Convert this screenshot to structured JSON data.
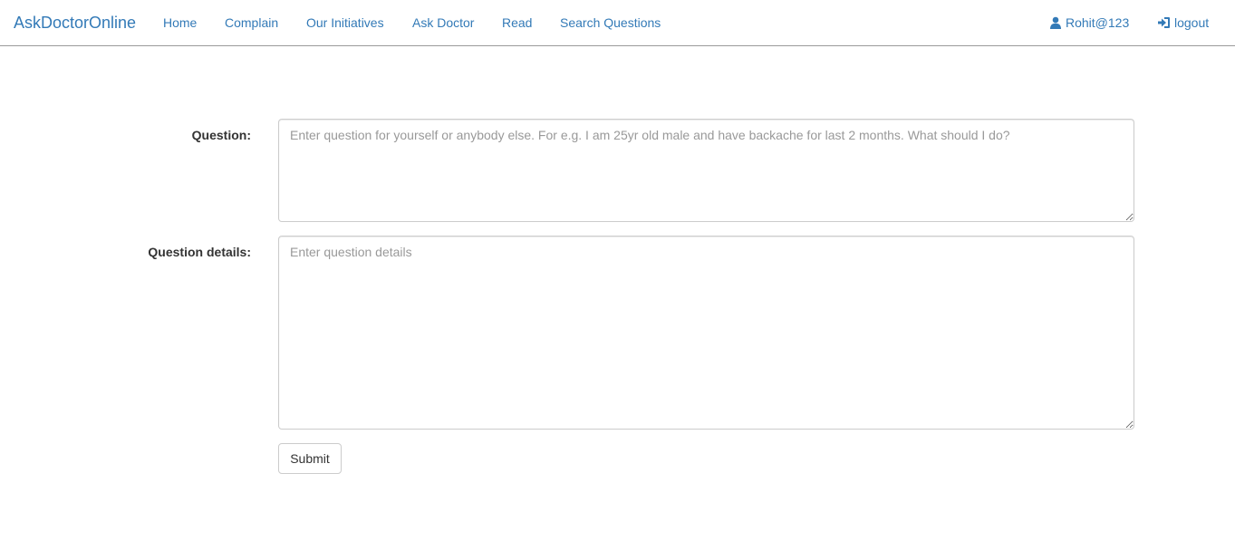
{
  "navbar": {
    "brand": "AskDoctorOnline",
    "links": [
      {
        "label": "Home"
      },
      {
        "label": "Complain"
      },
      {
        "label": "Our Initiatives"
      },
      {
        "label": "Ask Doctor"
      },
      {
        "label": "Read"
      },
      {
        "label": "Search Questions"
      }
    ],
    "user": {
      "label": "Rohit@123",
      "icon": "user-icon"
    },
    "logout": {
      "label": "logout",
      "icon": "login-icon"
    },
    "link_color": "#337ab7"
  },
  "form": {
    "question": {
      "label": "Question:",
      "value": "",
      "placeholder": "Enter question for yourself or anybody else. For e.g. I am 25yr old male and have backache for last 2 months. What should I do?"
    },
    "details": {
      "label": "Question details:",
      "value": "",
      "placeholder": "Enter question details"
    },
    "submit_label": "Submit"
  }
}
